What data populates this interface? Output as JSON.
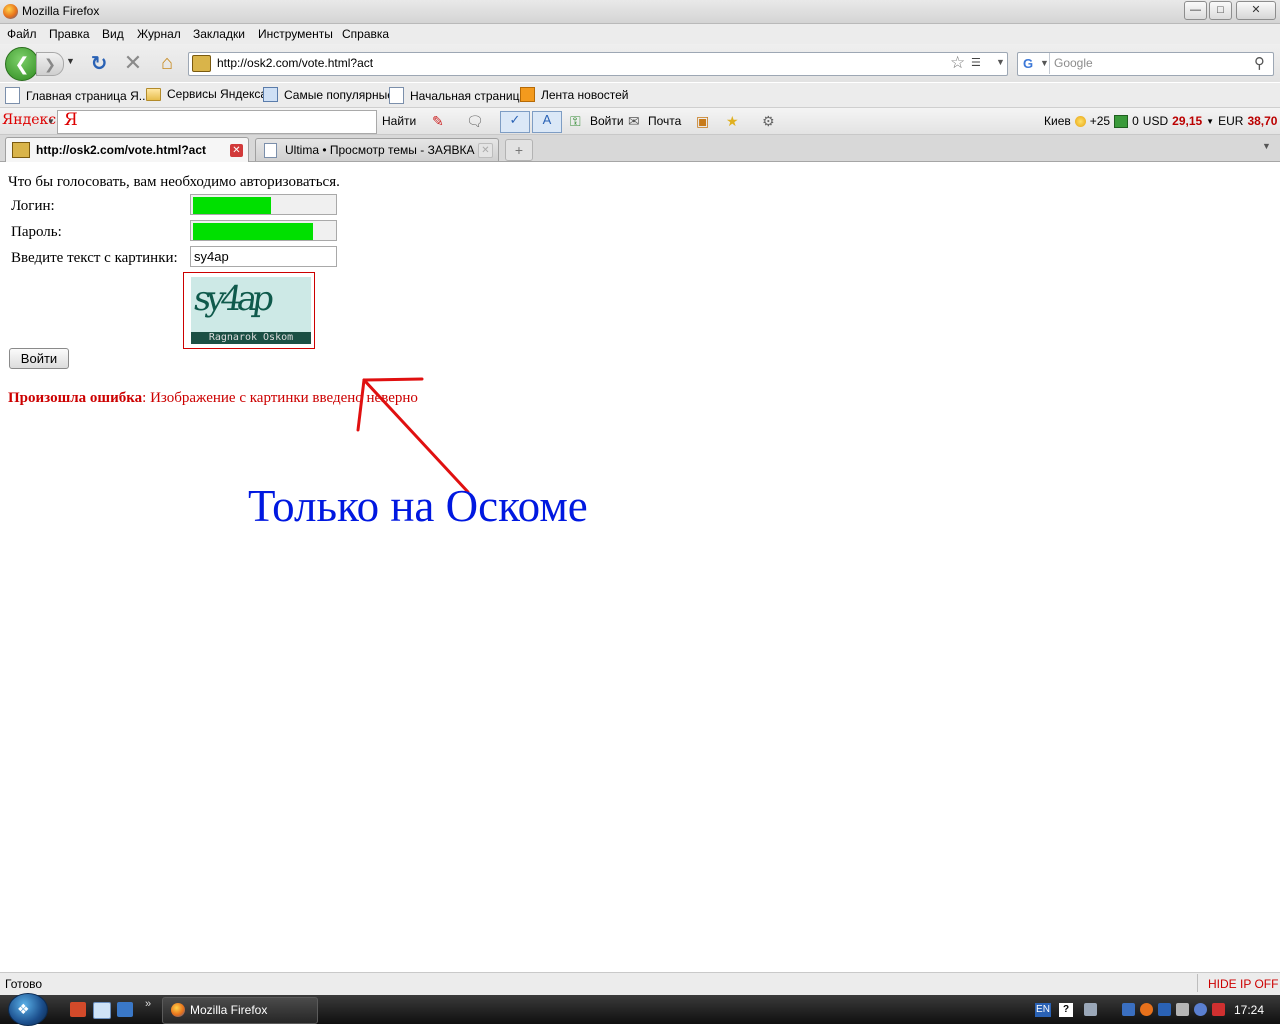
{
  "window": {
    "title": "Mozilla Firefox"
  },
  "menu": [
    "Файл",
    "Правка",
    "Вид",
    "Журнал",
    "Закладки",
    "Инструменты",
    "Справка"
  ],
  "nav": {
    "url": "http://osk2.com/vote.html?act",
    "search_placeholder": "Google"
  },
  "bookmarks": [
    {
      "label": "Главная страница Я...",
      "icon": "page-icon"
    },
    {
      "label": "Сервисы Яндекса",
      "icon": "folder-icon"
    },
    {
      "label": "Самые популярные",
      "icon": "popular-icon"
    },
    {
      "label": "Начальная страница",
      "icon": "page-icon"
    },
    {
      "label": "Лента новостей",
      "icon": "rss-icon"
    }
  ],
  "yandex": {
    "logo": "Яндекс",
    "search_glyph": "Я",
    "find_label": "Найти",
    "login_label": "Войти",
    "mail_label": "Почта",
    "city": "Киев",
    "weather": "+25",
    "mail_count": "0",
    "usd_label": "USD",
    "usd_rate": "29,15",
    "eur_label": "EUR",
    "eur_rate": "38,70"
  },
  "tabs": [
    {
      "label": "http://osk2.com/vote.html?act",
      "active": true
    },
    {
      "label": "Ultima • Просмотр темы - ЗАЯВКА",
      "active": false
    }
  ],
  "page": {
    "auth_message": "Что бы голосовать, вам необходимо авторизоваться.",
    "login_label": "Логин:",
    "password_label": "Пароль:",
    "captcha_label": "Введите текст с картинки:",
    "captcha_value": "sy4ap",
    "captcha_image_text": "sy4ap",
    "captcha_caption": "Ragnarok Oskom",
    "submit_label": "Войти",
    "error_label": "Произошла ошибка",
    "error_text": ": Изображение с картинки введено неверно",
    "annotation": "Только на Оскоме",
    "login_fill": 0.55,
    "password_fill": 0.85
  },
  "status": {
    "text": "Готово",
    "addon": "HIDE IP OFF"
  },
  "taskbar": {
    "task": "Mozilla Firefox",
    "lang": "EN",
    "time": "17:24"
  },
  "colors": {
    "error": "#cc0000",
    "annotation": "#0018e0",
    "field_fill": "#00e000"
  }
}
